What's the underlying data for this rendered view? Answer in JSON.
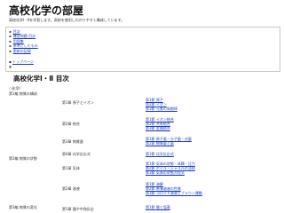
{
  "header": {
    "title": "高校化学の部屋",
    "intro": "高校化学Ⅰ・Ⅱを学習します。高校を使用しわかりやすく構成しています。"
  },
  "toc": {
    "items": [
      "目次",
      "練習問題 目次",
      "用語集",
      "参考にしたもの",
      "更新の記録"
    ],
    "top_link": "トップページ",
    "arrow": "▼"
  },
  "main": {
    "section_title": "高校化学Ⅰ・Ⅱ 目次",
    "subject": "○化学Ⅰ",
    "parts": [
      "第1編 物質の構成",
      "第2編 物質の状態",
      "第3編 物質の変化"
    ],
    "chapters": [
      "第1章 原子とイオン",
      "第2章 結合",
      "第3章 物質量",
      "第4章 化学反応式",
      "第1章 気体",
      "第2章 溶液",
      "第1章 酸や中和反応"
    ],
    "sections": [
      "第1節 原子",
      "第2節 イオン",
      "第3節 元素の周期律",
      "第1節 イオン結合",
      "第2節 共有結合",
      "第3節 金属結合",
      "第1節 原子量・分子量・式量",
      "第2節 物質量と量",
      "第1節 化学反応式",
      "第1節 気体の状態・体積・圧力",
      "第2節 ボイル・シャルルの法則",
      "第3節 気体の状態方程式",
      "第1節 溶解",
      "第2節 希薄溶液の性質",
      "第3節 コロイド溶液とブラウン運動",
      "第1節 酸と塩基"
    ]
  }
}
